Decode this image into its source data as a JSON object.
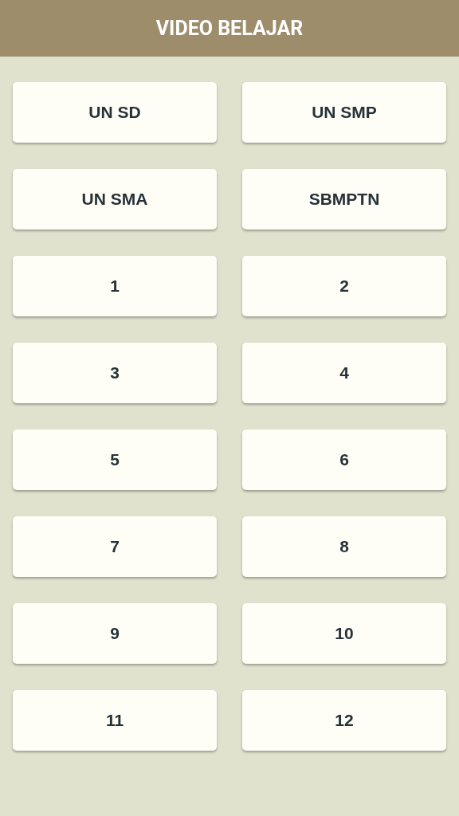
{
  "app_bar": {
    "title": "VIDEO BELAJAR"
  },
  "buttons": [
    {
      "label": "UN SD"
    },
    {
      "label": "UN SMP"
    },
    {
      "label": "UN SMA"
    },
    {
      "label": "SBMPTN"
    },
    {
      "label": "1"
    },
    {
      "label": "2"
    },
    {
      "label": "3"
    },
    {
      "label": "4"
    },
    {
      "label": "5"
    },
    {
      "label": "6"
    },
    {
      "label": "7"
    },
    {
      "label": "8"
    },
    {
      "label": "9"
    },
    {
      "label": "10"
    },
    {
      "label": "11"
    },
    {
      "label": "12"
    }
  ]
}
